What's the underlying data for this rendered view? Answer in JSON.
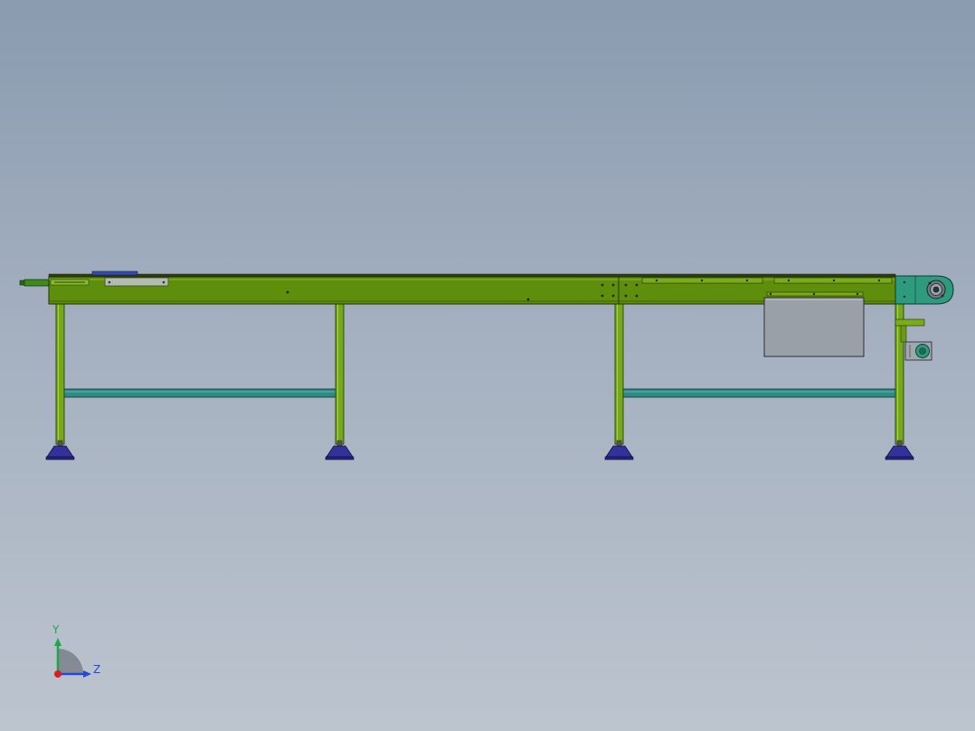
{
  "colors": {
    "background_top": "#8a9bb0",
    "background_bottom": "#bcc4ce",
    "frame_green": "#5f8e0c",
    "frame_light_green": "#7aab1a",
    "leg_green": "#76a81c",
    "crossbar_teal": "#2f8a86",
    "foot_blue": "#32329a",
    "motor_teal": "#2e9a7e",
    "panel_grey": "#9aa0a8",
    "axis_y": "#1aa64a",
    "axis_z": "#2448d8",
    "axis_x": "#d81e1e"
  },
  "triad": {
    "y_label": "Y",
    "z_label": "Z"
  },
  "icons": {
    "triad": "coordinate-triad-icon",
    "motor": "drive-motor-icon",
    "pulley": "head-pulley-icon"
  }
}
